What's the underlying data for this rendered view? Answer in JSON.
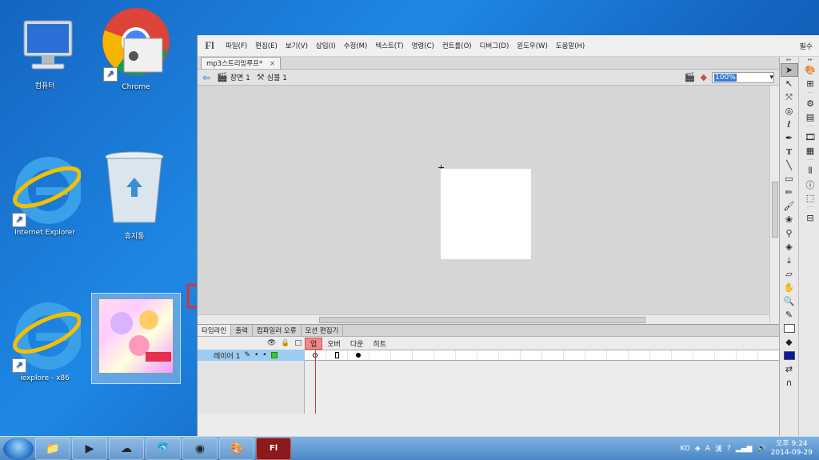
{
  "desktop": {
    "icons": [
      {
        "label": "컴퓨터"
      },
      {
        "label": "Chrome"
      },
      {
        "label": "Internet Explorer"
      },
      {
        "label": "휴지통"
      },
      {
        "label": "iexplore - x86"
      }
    ]
  },
  "flash": {
    "logo": "Fl",
    "menu": [
      "파일(F)",
      "편집(E)",
      "보기(V)",
      "삽입(I)",
      "수정(M)",
      "텍스트(T)",
      "명령(C)",
      "컨트롤(O)",
      "디버그(D)",
      "윈도우(W)",
      "도움말(H)"
    ],
    "mode": "필수",
    "doc_tab": "mp3스트리밍루프*",
    "doc_tab_close": "×",
    "breadcrumb": {
      "scene": "장면 1",
      "symbol": "심볼 1"
    },
    "zoom": "100%",
    "panel_tabs": [
      "타임라인",
      "출력",
      "컴파일러 오류",
      "모션 편집기"
    ],
    "timeline": {
      "frame_labels": [
        "업",
        "오버",
        "다운",
        "히트"
      ],
      "layer_name": "레이어 1"
    }
  },
  "taskbar": {
    "lang": "KO",
    "time": "오후 9:24",
    "date": "2014-09-29"
  },
  "colors": {
    "accent_red": "#e03030",
    "fill_swatch": "#0a1aa0"
  }
}
